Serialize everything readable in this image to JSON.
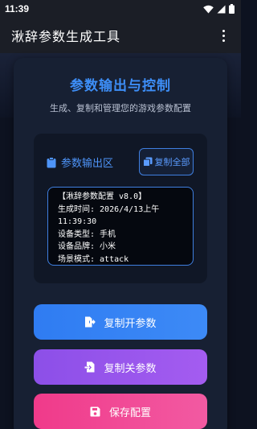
{
  "status_bar": {
    "time": "11:39",
    "icons": [
      "wifi-icon",
      "signal-icon",
      "battery-icon"
    ]
  },
  "app_bar": {
    "title": "湫辞参数生成工具",
    "menu_icon": "more-vert-icon"
  },
  "card": {
    "title": "参数输出与控制",
    "subtitle": "生成、复制和管理您的游戏参数配置"
  },
  "output_panel": {
    "icon": "clipboard-icon",
    "title": "参数输出区",
    "copy_all_label": "复制全部",
    "copy_all_icon": "copy-icon",
    "lines": [
      "【湫辞参数配置 v8.0】",
      "生成时间: 2026/4/13上午",
      "11:39:30",
      "设备类型: 手机",
      "设备品牌: 小米",
      "场景模式: attack"
    ]
  },
  "actions": {
    "open_label": "复制开参数",
    "open_icon": "file-export-icon",
    "close_label": "复制关参数",
    "close_icon": "file-import-icon",
    "save_label": "保存配置",
    "save_icon": "save-icon"
  },
  "colors": {
    "accent_blue": "#3d8ef7",
    "button_open": "#2f7cf2",
    "button_close": "#9a56ec",
    "button_save": "#f2458f",
    "background": "#0d1220",
    "card": "#172033"
  }
}
